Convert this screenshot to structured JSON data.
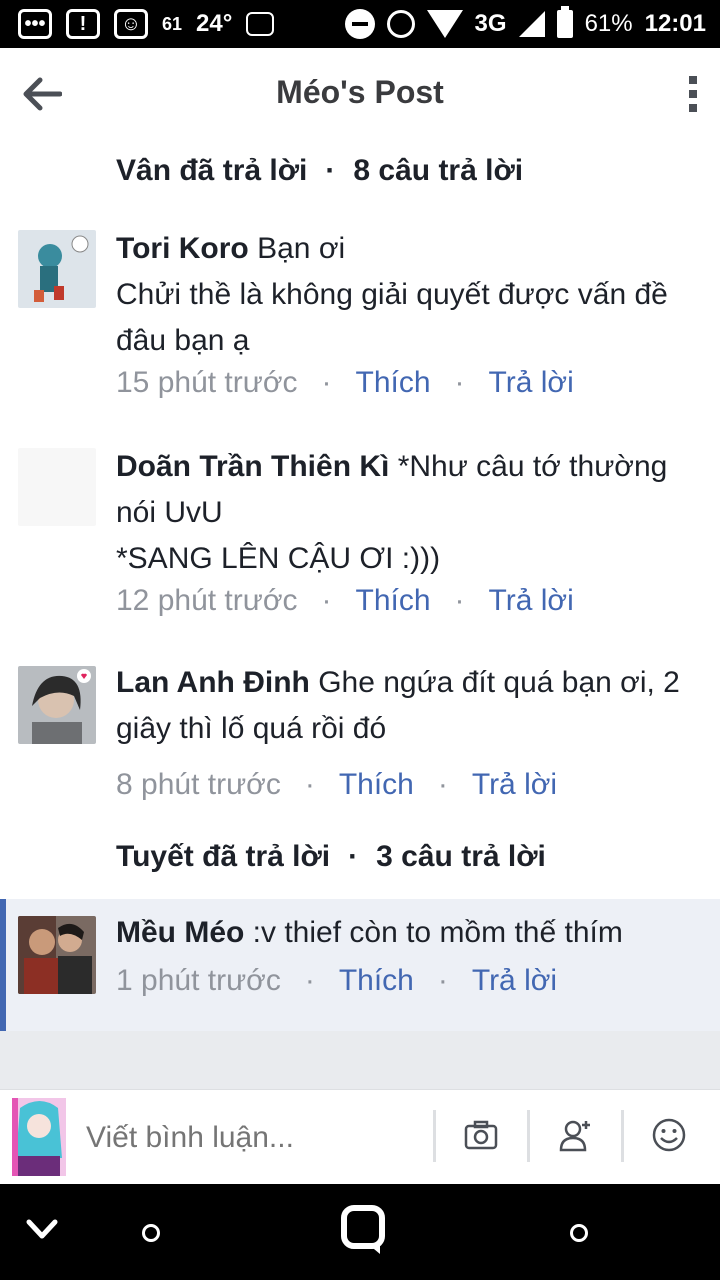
{
  "status_bar": {
    "icons_left": [
      "chat-icon",
      "alert-icon",
      "face-icon",
      "signal-small-icon",
      "avatar-small-icon",
      "image-icon"
    ],
    "notif_small": "61",
    "temperature": "24°",
    "network": "3G",
    "battery": "61%",
    "time": "12:01"
  },
  "header": {
    "title": "Méo's Post"
  },
  "summaries": [
    {
      "name_text": "Vân đã trả lời",
      "count_text": "8 câu trả lời",
      "dot": "·"
    },
    {
      "name_text": "Tuyết đã trả lời",
      "count_text": "3 câu trả lời",
      "dot": "·"
    }
  ],
  "comments": [
    {
      "author": "Tori Koro",
      "text": " Bạn ơi\nChửi thề là không giải quyết được vấn đề đâu bạn ạ",
      "time": "15 phút trước",
      "like": "Thích",
      "reply": "Trả lời",
      "avatar_color": "#c9d6e3"
    },
    {
      "author": "Doãn Trần Thiên Kì",
      "text": " *Như câu tớ thường nói UvU\n*SANG LÊN CẬU ƠI :)))",
      "time": "12 phút trước",
      "like": "Thích",
      "reply": "Trả lời",
      "avatar_color": "#f7f7f7"
    },
    {
      "author": "Lan Anh Đinh",
      "text": " Ghe ngứa đít quá bạn ơi, 2 giây thì lố quá rồi đó",
      "time": "8 phút trước",
      "like": "Thích",
      "reply": "Trả lời",
      "avatar_color": "#9aa0a6"
    },
    {
      "author": "Mều Méo",
      "text": " :v thief còn to mồm thế thím",
      "time": "1 phút trước",
      "like": "Thích",
      "reply": "Trả lời",
      "avatar_color": "#5a3d35"
    }
  ],
  "composer": {
    "placeholder": "Viết bình luận..."
  },
  "colors": {
    "link": "#4267b2",
    "meta": "#90949c",
    "highlight": "#edf0f6"
  }
}
